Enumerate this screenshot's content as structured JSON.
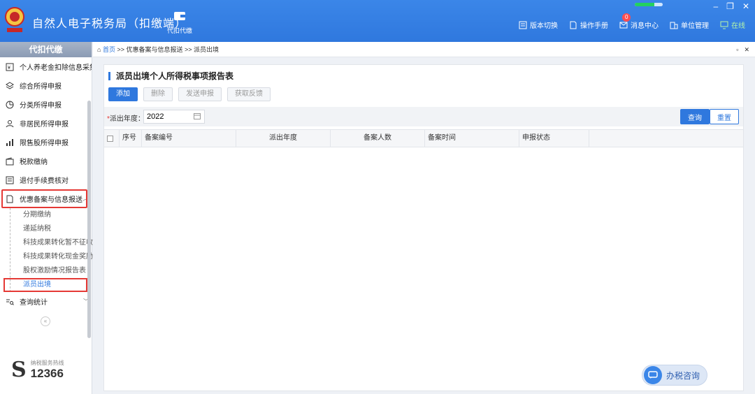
{
  "header": {
    "app_title": "自然人电子税务局（扣缴端）",
    "nav_daikou": "代扣代缴",
    "actions": [
      {
        "label": "版本切换",
        "icon": "version-switch-icon"
      },
      {
        "label": "操作手册",
        "icon": "manual-icon"
      },
      {
        "label": "消息中心",
        "icon": "message-icon"
      },
      {
        "label": "单位管理",
        "icon": "unit-manage-icon"
      }
    ],
    "message_count": "0",
    "online": "在线",
    "progress": 0.7,
    "colors": {
      "header_bg": "#2f78de",
      "accent": "#2f78de",
      "highlight": "#e53935"
    }
  },
  "sidebar": {
    "title": "代扣代缴",
    "items": [
      {
        "label": "个人养老金扣除信息采集",
        "icon": "pension-icon"
      },
      {
        "label": "综合所得申报",
        "icon": "layers-icon"
      },
      {
        "label": "分类所得申报",
        "icon": "pie-icon"
      },
      {
        "label": "非居民所得申报",
        "icon": "person-icon"
      },
      {
        "label": "限售股所得申报",
        "icon": "bar-chart-icon"
      },
      {
        "label": "税款缴纳",
        "icon": "wallet-icon"
      },
      {
        "label": "退付手续费核对",
        "icon": "list-icon"
      },
      {
        "label": "优惠备案与信息报送",
        "icon": "doc-icon"
      }
    ],
    "sub_items": [
      {
        "label": "分期缴纳"
      },
      {
        "label": "递延纳税"
      },
      {
        "label": "科技成果转化暂不征收"
      },
      {
        "label": "科技成果转化现金奖励"
      },
      {
        "label": "股权激励情况报告表"
      },
      {
        "label": "派员出境"
      }
    ],
    "query_stats": "查询统计",
    "hotline_label": "纳税服务热线",
    "hotline_number": "12366"
  },
  "breadcrumb": {
    "home": "首页",
    "sep": " >> ",
    "level1": "优惠备案与信息报送",
    "level2": "派员出境"
  },
  "panel": {
    "title": "派员出境个人所得税事项报告表",
    "toolbar": {
      "add": "添加",
      "delete": "删除",
      "send": "发送申报",
      "feedback": "获取反馈"
    },
    "filter": {
      "label": "派出年度：",
      "year": "2022",
      "query": "查询",
      "reset": "重置"
    },
    "columns": [
      "序号",
      "备案编号",
      "派出年度",
      "备案人数",
      "备案时间",
      "申报状态"
    ]
  },
  "consult": "办税咨询"
}
